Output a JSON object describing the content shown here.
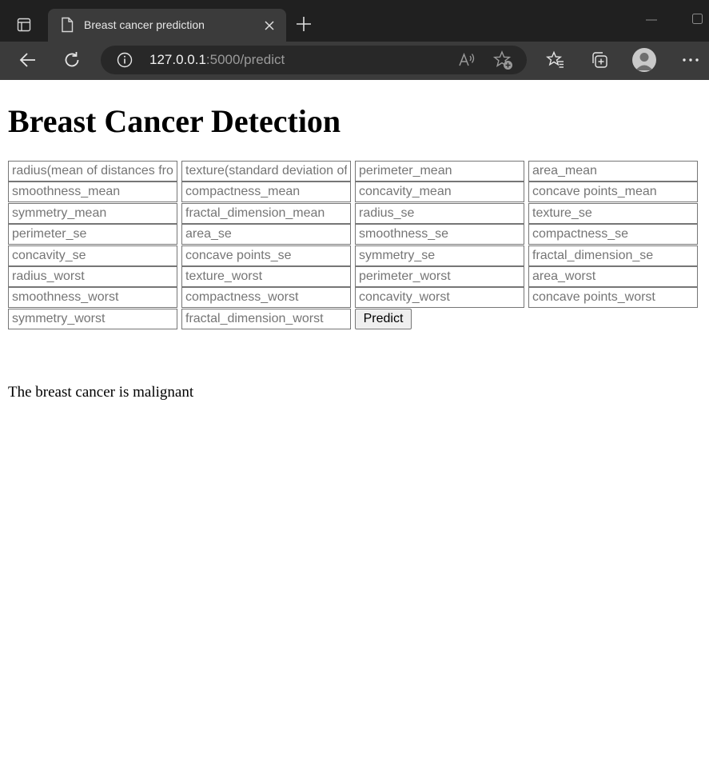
{
  "browser": {
    "tab_title": "Breast cancer prediction",
    "url_host": "127.0.0.1",
    "url_path": ":5000/predict",
    "icons": [
      "tab-actions-icon",
      "page-icon",
      "close-icon",
      "plus-icon",
      "minimize-icon",
      "maximize-icon",
      "back-arrow-icon",
      "refresh-icon",
      "info-icon",
      "read-aloud-icon",
      "add-favorite-icon",
      "favorites-icon",
      "collections-icon",
      "profile-avatar-icon",
      "more-menu-icon"
    ],
    "colors": {
      "tabbar": "#202020",
      "toolbar": "#3b3b3b",
      "omnibox": "#282828"
    }
  },
  "page": {
    "title": "Breast Cancer Detection",
    "fields": [
      "radius(mean of distances from center to points on the perimeter)",
      "texture(standard deviation of gray-scale values)",
      "perimeter_mean",
      "area_mean",
      "smoothness_mean",
      "compactness_mean",
      "concavity_mean",
      "concave points_mean",
      "symmetry_mean",
      "fractal_dimension_mean",
      "radius_se",
      "texture_se",
      "perimeter_se",
      "area_se",
      "smoothness_se",
      "compactness_se",
      "concavity_se",
      "concave points_se",
      "symmetry_se",
      "fractal_dimension_se",
      "radius_worst",
      "texture_worst",
      "perimeter_worst",
      "area_worst",
      "smoothness_worst",
      "compactness_worst",
      "concavity_worst",
      "concave points_worst",
      "symmetry_worst",
      "fractal_dimension_worst"
    ],
    "predict_label": "Predict",
    "result": "The breast cancer is malignant"
  }
}
